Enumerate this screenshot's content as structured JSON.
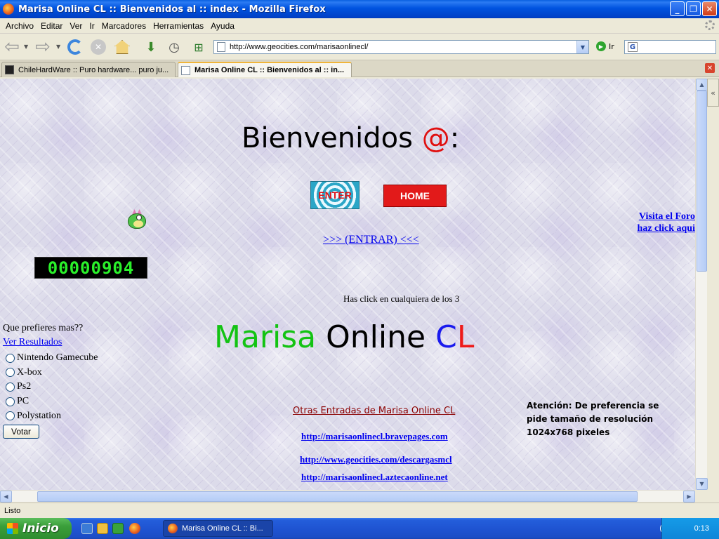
{
  "window": {
    "title": "Marisa Online CL :: Bienvenidos al :: index - Mozilla Firefox"
  },
  "menu": [
    "Archivo",
    "Editar",
    "Ver",
    "Ir",
    "Marcadores",
    "Herramientas",
    "Ayuda"
  ],
  "navbar": {
    "url": "http://www.geocities.com/marisaonlinecl/",
    "go_label": "Ir"
  },
  "tabs": [
    {
      "label": "ChileHardWare :: Puro hardware... puro ju..."
    },
    {
      "label": "Marisa Online CL :: Bienvenidos al :: in..."
    }
  ],
  "page": {
    "welcome_text": "Bienvenidos",
    "welcome_at": "@",
    "welcome_colon": ":",
    "enter_button": "ENTER",
    "home_button": "HOME",
    "forum_link_line1": "Visita el Foro",
    "forum_link_line2": "haz click aqui",
    "entrar_link": ">>> (ENTRAR) <<<",
    "counter": "00000904",
    "click_hint": "Has click en cualquiera de los 3",
    "brand": {
      "part1": "Marisa",
      "part2": "Online",
      "part3": "C",
      "part4": "L"
    },
    "poll": {
      "question": "Que prefieres mas??",
      "results_link": "Ver Resultados",
      "options": [
        "Nintendo Gamecube",
        "X-box",
        "Ps2",
        "PC",
        "Polystation"
      ],
      "vote_button": "Votar"
    },
    "other_entries_title": "Otras Entradas de Marisa Online CL",
    "other_links": [
      "http://marisaonlinecl.bravepages.com",
      "http://www.geocities.com/descargasmcl",
      "http://marisaonlinecl.aztecaonline.net"
    ],
    "attention_text": "Atención: De preferencia se pide tamaño de resolución 1024x768 pixeles"
  },
  "statusbar": {
    "text": "Listo"
  },
  "taskbar": {
    "start_label": "Inicio",
    "task_label": "Marisa Online CL :: Bi...",
    "clock": "0:13"
  }
}
